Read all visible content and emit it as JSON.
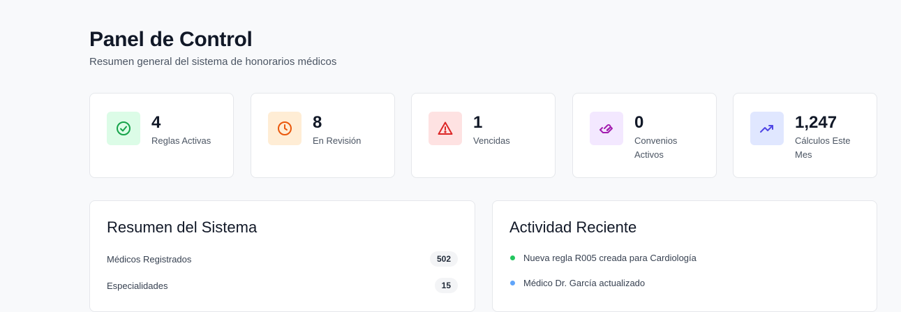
{
  "header": {
    "title": "Panel de Control",
    "subtitle": "Resumen general del sistema de honorarios médicos"
  },
  "stats": [
    {
      "value": "4",
      "label": "Reglas Activas",
      "icon": "check-circle-icon",
      "color": "#16a34a",
      "bg": "#dcfce7"
    },
    {
      "value": "8",
      "label": "En Revisión",
      "icon": "clock-icon",
      "color": "#ea580c",
      "bg": "#ffedd5"
    },
    {
      "value": "1",
      "label": "Vencidas",
      "icon": "alert-triangle-icon",
      "color": "#dc2626",
      "bg": "#fee2e2"
    },
    {
      "value": "0",
      "label": "Convenios Activos",
      "icon": "handshake-icon",
      "color": "#a21caf",
      "bg": "#f3e8ff"
    },
    {
      "value": "1,247",
      "label": "Cálculos Este Mes",
      "icon": "trending-up-icon",
      "color": "#4f46e5",
      "bg": "#e0e7ff"
    }
  ],
  "summary": {
    "title": "Resumen del Sistema",
    "rows": [
      {
        "label": "Médicos Registrados",
        "value": "502"
      },
      {
        "label": "Especialidades",
        "value": "15"
      }
    ]
  },
  "activity": {
    "title": "Actividad Reciente",
    "items": [
      {
        "text": "Nueva regla R005 creada para Cardiología",
        "color": "#22c55e"
      },
      {
        "text": "Médico Dr. García actualizado",
        "color": "#60a5fa"
      }
    ]
  }
}
